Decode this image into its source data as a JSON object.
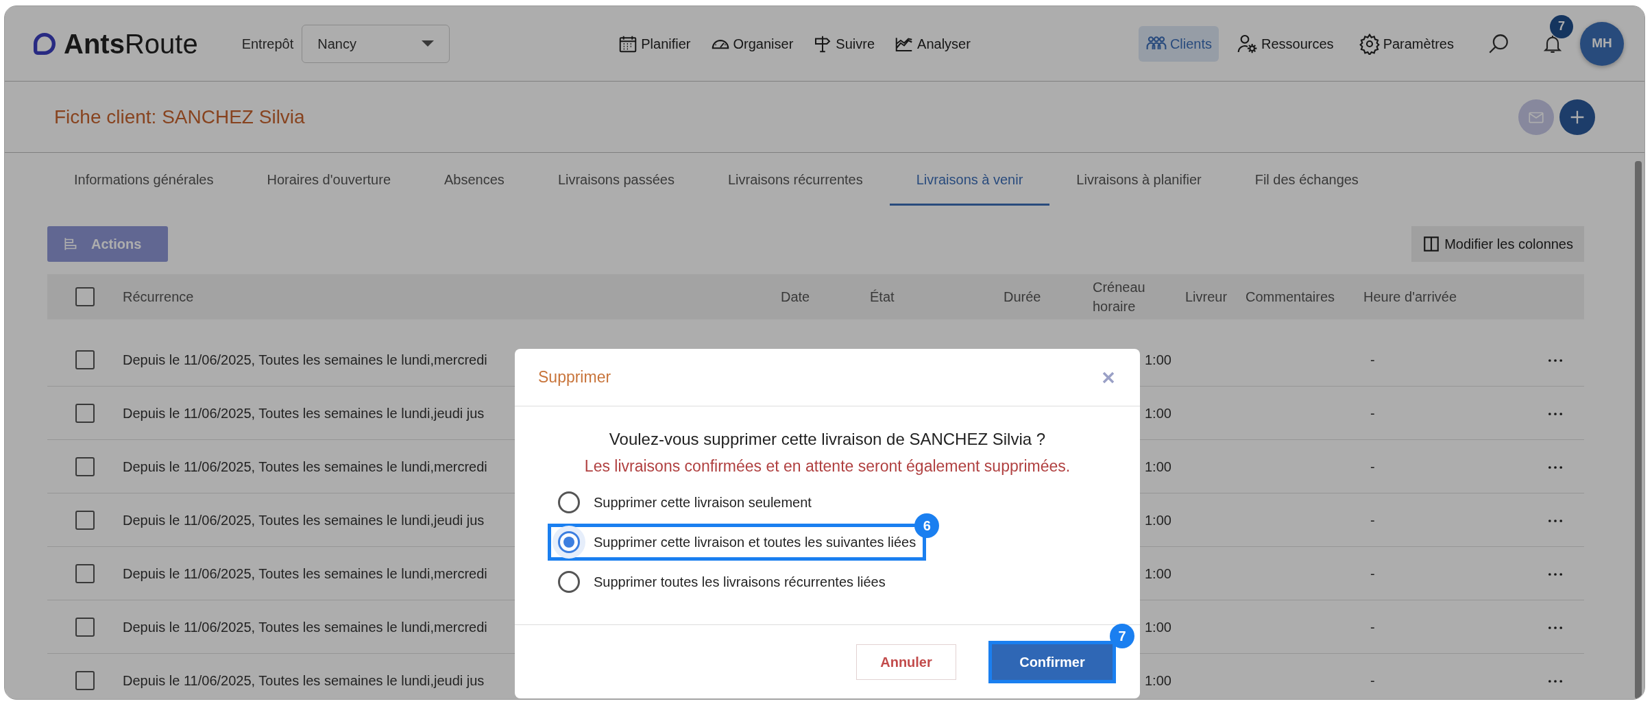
{
  "navbar": {
    "logo": {
      "bold": "Ants",
      "light": "Route"
    },
    "warehouse_label": "Entrepôt",
    "warehouse_value": "Nancy",
    "menu": [
      {
        "label": "Planifier",
        "selected": false
      },
      {
        "label": "Organiser",
        "selected": false
      },
      {
        "label": "Suivre",
        "selected": false
      },
      {
        "label": "Analyser",
        "selected": false
      }
    ],
    "right_menu": [
      {
        "label": "Clients",
        "selected": true
      },
      {
        "label": "Ressources",
        "selected": false
      },
      {
        "label": "Paramètres",
        "selected": false
      }
    ],
    "notification_count": "7",
    "avatar": "MH"
  },
  "header": {
    "title": "Fiche client: SANCHEZ Silvia"
  },
  "tabs": [
    {
      "label": "Informations générales",
      "selected": false
    },
    {
      "label": "Horaires d'ouverture",
      "selected": false
    },
    {
      "label": "Absences",
      "selected": false
    },
    {
      "label": "Livraisons passées",
      "selected": false
    },
    {
      "label": "Livraisons récurrentes",
      "selected": false
    },
    {
      "label": "Livraisons à venir",
      "selected": true
    },
    {
      "label": "Livraisons à planifier",
      "selected": false
    },
    {
      "label": "Fil des échanges",
      "selected": false
    }
  ],
  "toolbar": {
    "actions": "Actions",
    "actions_disabled": true,
    "columns_button": "Modifier les colonnes"
  },
  "table": {
    "header_checked": false,
    "columns": [
      "Récurrence",
      "Date",
      "État",
      "Durée",
      "Créneau horaire",
      "Livreur",
      "Commentaires",
      "Heure d'arrivée"
    ],
    "rows": [
      {
        "checked": false,
        "recurrence": "Depuis le 11/06/2025, Toutes les semaines le lundi,mercredi",
        "slot": "1:00",
        "arrival": "-"
      },
      {
        "checked": false,
        "recurrence": "Depuis le 11/06/2025, Toutes les semaines le lundi,jeudi jus",
        "slot": "1:00",
        "arrival": "-"
      },
      {
        "checked": false,
        "recurrence": "Depuis le 11/06/2025, Toutes les semaines le lundi,mercredi",
        "slot": "1:00",
        "arrival": "-"
      },
      {
        "checked": false,
        "recurrence": "Depuis le 11/06/2025, Toutes les semaines le lundi,jeudi jus",
        "slot": "1:00",
        "arrival": "-"
      },
      {
        "checked": false,
        "recurrence": "Depuis le 11/06/2025, Toutes les semaines le lundi,mercredi",
        "slot": "1:00",
        "arrival": "-"
      },
      {
        "checked": false,
        "recurrence": "Depuis le 11/06/2025, Toutes les semaines le lundi,mercredi",
        "slot": "1:00",
        "arrival": "-"
      },
      {
        "checked": false,
        "recurrence": "Depuis le 11/06/2025, Toutes les semaines le lundi,jeudi jus",
        "slot": "1:00",
        "arrival": "-"
      }
    ]
  },
  "dialog": {
    "title": "Supprimer",
    "question": "Voulez-vous supprimer cette livraison de SANCHEZ Silvia ?",
    "warning": "Les livraisons confirmées et en attente seront également supprimées.",
    "options": [
      {
        "label": "Supprimer cette livraison seulement",
        "selected": false
      },
      {
        "label": "Supprimer cette livraison et toutes les suivantes liées",
        "selected": true,
        "step": "6"
      },
      {
        "label": "Supprimer toutes les livraisons récurrentes liées",
        "selected": false
      }
    ],
    "cancel": "Annuler",
    "confirm": "Confirmer",
    "confirm_step": "7"
  }
}
